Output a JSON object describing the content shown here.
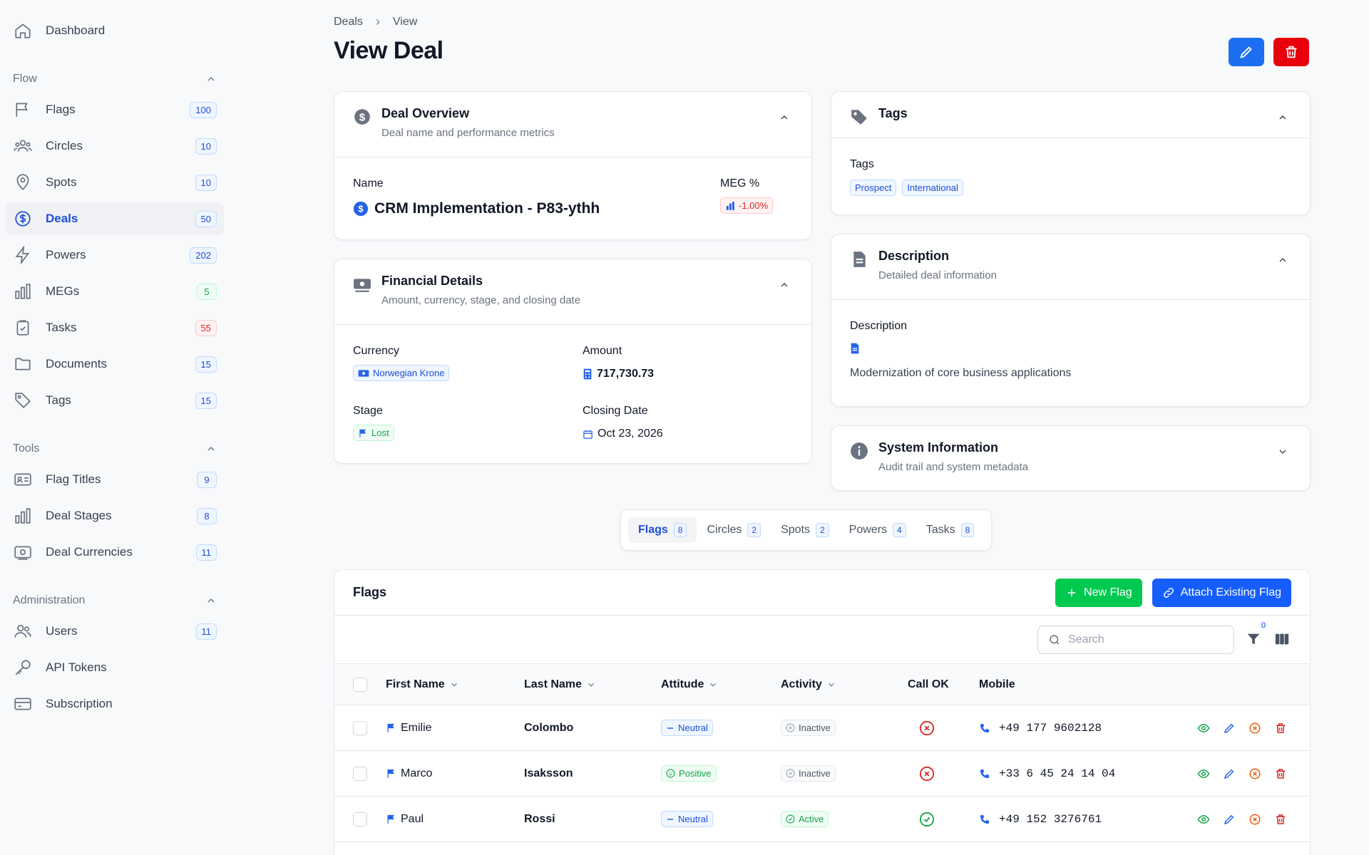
{
  "sidebar": {
    "dashboard": "Dashboard",
    "sections": {
      "flow": "Flow",
      "tools": "Tools",
      "administration": "Administration"
    },
    "flow_items": [
      {
        "label": "Flags",
        "count": "100",
        "color": "blue"
      },
      {
        "label": "Circles",
        "count": "10",
        "color": "blue"
      },
      {
        "label": "Spots",
        "count": "10",
        "color": "blue"
      },
      {
        "label": "Deals",
        "count": "50",
        "color": "blue",
        "active": true
      },
      {
        "label": "Powers",
        "count": "202",
        "color": "blue"
      },
      {
        "label": "MEGs",
        "count": "5",
        "color": "green"
      },
      {
        "label": "Tasks",
        "count": "55",
        "color": "red"
      },
      {
        "label": "Documents",
        "count": "15",
        "color": "blue"
      },
      {
        "label": "Tags",
        "count": "15",
        "color": "blue"
      }
    ],
    "tools_items": [
      {
        "label": "Flag Titles",
        "count": "9"
      },
      {
        "label": "Deal Stages",
        "count": "8"
      },
      {
        "label": "Deal Currencies",
        "count": "11"
      }
    ],
    "admin_items": [
      {
        "label": "Users",
        "count": "11"
      },
      {
        "label": "API Tokens"
      },
      {
        "label": "Subscription"
      }
    ]
  },
  "header": {
    "breadcrumb": [
      "Deals",
      "View"
    ],
    "title": "View Deal",
    "colors": {
      "edit": "#1d6ff2",
      "delete": "#e7000b"
    }
  },
  "overview": {
    "title": "Deal Overview",
    "subtitle": "Deal name and performance metrics",
    "name_label": "Name",
    "name_value": "CRM Implementation - P83-ythh",
    "meg_label": "MEG %",
    "meg_value": "-1.00%"
  },
  "financial": {
    "title": "Financial Details",
    "subtitle": "Amount, currency, stage, and closing date",
    "currency_label": "Currency",
    "currency_value": "Norwegian Krone",
    "amount_label": "Amount",
    "amount_value": "717,730.73",
    "stage_label": "Stage",
    "stage_value": "Lost",
    "closing_label": "Closing Date",
    "closing_value": "Oct 23, 2026"
  },
  "tags_card": {
    "title": "Tags",
    "label": "Tags",
    "tags": [
      "Prospect",
      "International"
    ]
  },
  "description_card": {
    "title": "Description",
    "subtitle": "Detailed deal information",
    "label": "Description",
    "value": "Modernization of core business applications"
  },
  "system_card": {
    "title": "System Information",
    "subtitle": "Audit trail and system metadata"
  },
  "tabs": [
    {
      "label": "Flags",
      "count": "8",
      "active": true
    },
    {
      "label": "Circles",
      "count": "2"
    },
    {
      "label": "Spots",
      "count": "2"
    },
    {
      "label": "Powers",
      "count": "4"
    },
    {
      "label": "Tasks",
      "count": "8"
    }
  ],
  "flags_table": {
    "title": "Flags",
    "new_button": "New Flag",
    "attach_button": "Attach Existing Flag",
    "search_placeholder": "Search",
    "filter_count": "0",
    "columns": [
      "First Name",
      "Last Name",
      "Attitude",
      "Activity",
      "Call OK",
      "Mobile"
    ],
    "rows": [
      {
        "first": "Emilie",
        "last": "Colombo",
        "attitude": "Neutral",
        "activity": "Inactive",
        "call_ok": false,
        "mobile": "+49 177 9602128"
      },
      {
        "first": "Marco",
        "last": "Isaksson",
        "attitude": "Positive",
        "activity": "Inactive",
        "call_ok": false,
        "mobile": "+33 6 45 24 14 04"
      },
      {
        "first": "Paul",
        "last": "Rossi",
        "attitude": "Neutral",
        "activity": "Active",
        "call_ok": true,
        "mobile": "+49 152 3276761"
      }
    ],
    "colors": {
      "new": "#00c950",
      "attach": "#155dfc"
    }
  }
}
